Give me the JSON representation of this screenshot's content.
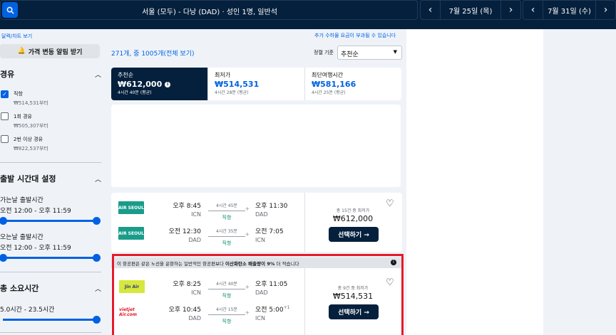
{
  "header": {
    "route": "서울 (모두) - 다낭 (DAD)  ·  성인 1명, 일반석",
    "depart_date": "7월 25일 (목)",
    "return_date": "7월 31일 (수)",
    "prev": "‹",
    "next": "›"
  },
  "sidebar": {
    "chart_link": "달력/차트 보기",
    "alert_button": "가격 변동 알림 받기",
    "stops": {
      "title": "경유",
      "items": [
        {
          "label": "직항",
          "price": "₩514,531부터",
          "checked": true
        },
        {
          "label": "1회 경유",
          "price": "₩505,307부터",
          "checked": false
        },
        {
          "label": "2번 이상 경유",
          "price": "₩822,537부터",
          "checked": false
        }
      ]
    },
    "times": {
      "title": "출발 시간대 설정",
      "outbound_label": "가는날 출발시간",
      "outbound_range": "오전 12:00 - 오후 11:59",
      "return_label": "오는날 출발시간",
      "return_range": "오전 12:00 - 오후 11:59"
    },
    "duration": {
      "title": "총 소요시간",
      "range": "5.0시간 - 23.5시간"
    }
  },
  "results": {
    "count": "271개, 중 1005개(전체 보기)",
    "fee_note": "추가 수하물 요금이 부과될 수 있습니다",
    "sort_label": "정렬 기준",
    "sort_value": "추천순",
    "tabs": [
      {
        "label": "추천순",
        "price": "₩612,000",
        "sub": "4시간 40분 (평균)"
      },
      {
        "label": "최저가",
        "price": "₩514,531",
        "sub": "4시간 28분 (평균)"
      },
      {
        "label": "최단여행시간",
        "price": "₩581,166",
        "sub": "4시간 25분 (평균)"
      }
    ]
  },
  "card1": {
    "legs": [
      {
        "airline": "AIR SEOUL",
        "dep_time": "오후 8:45",
        "dep_code": "ICN",
        "duration": "4시간 45분",
        "stops": "직항",
        "arr_time": "오후 11:30",
        "arr_code": "DAD"
      },
      {
        "airline": "AIR SEOUL",
        "dep_time": "오전 12:30",
        "dep_code": "DAD",
        "duration": "4시간 35분",
        "stops": "직항",
        "arr_time": "오전 7:05",
        "arr_code": "ICN"
      }
    ],
    "deals": "총 15건 중 최저가",
    "price": "₩612,000",
    "select": "선택하기 →"
  },
  "card2": {
    "notice_pre": "이 항공편은 같은 노선을 운항하는 일반적인 항공편보다 ",
    "notice_bold": "이산화탄소 배출량이 9%",
    "notice_post": " 더 적습니다",
    "legs": [
      {
        "airline": "Jin Air",
        "dep_time": "오후 8:25",
        "dep_code": "ICN",
        "duration": "4시간 40분",
        "stops": "직항",
        "arr_time": "오후 11:05",
        "arr_code": "DAD"
      },
      {
        "airline": "vietjet Air.com",
        "dep_time": "오후 10:45",
        "dep_code": "DAD",
        "duration": "4시간 15분",
        "stops": "직항",
        "arr_time": "오전 5:00",
        "arr_suffix": "+1",
        "arr_code": "ICN"
      }
    ],
    "deals": "총 9건 중 최저가",
    "price": "₩514,531",
    "select": "선택하기 →"
  }
}
